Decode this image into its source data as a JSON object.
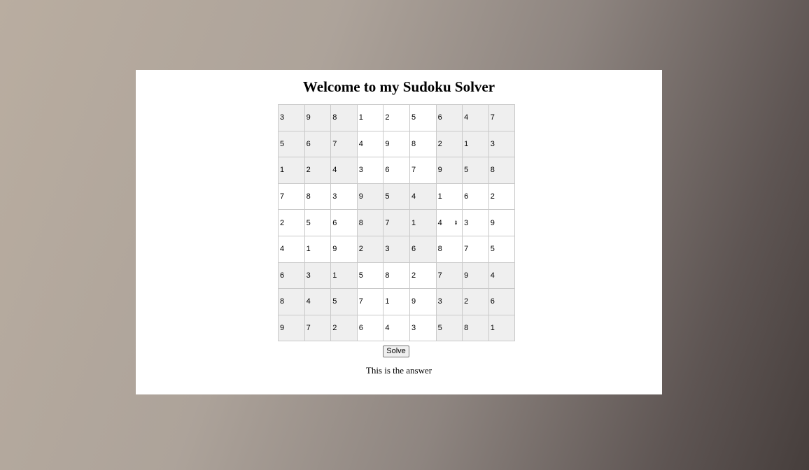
{
  "page": {
    "title": "Welcome to my Sudoku Solver",
    "solve_label": "Solve",
    "answer_text": "This is the answer"
  },
  "grid": [
    [
      "3",
      "9",
      "8",
      "1",
      "2",
      "5",
      "6",
      "4",
      "7"
    ],
    [
      "5",
      "6",
      "7",
      "4",
      "9",
      "8",
      "2",
      "1",
      "3"
    ],
    [
      "1",
      "2",
      "4",
      "3",
      "6",
      "7",
      "9",
      "5",
      "8"
    ],
    [
      "7",
      "8",
      "3",
      "9",
      "5",
      "4",
      "1",
      "6",
      "2"
    ],
    [
      "2",
      "5",
      "6",
      "8",
      "7",
      "1",
      "4",
      "3",
      "9"
    ],
    [
      "4",
      "1",
      "9",
      "2",
      "3",
      "6",
      "8",
      "7",
      "5"
    ],
    [
      "6",
      "3",
      "1",
      "5",
      "8",
      "2",
      "7",
      "9",
      "4"
    ],
    [
      "8",
      "4",
      "5",
      "7",
      "1",
      "9",
      "3",
      "2",
      "6"
    ],
    [
      "9",
      "7",
      "2",
      "6",
      "4",
      "3",
      "5",
      "8",
      "1"
    ]
  ],
  "focused_cell": {
    "row": 4,
    "col": 6
  },
  "colors": {
    "shaded_box": "#efefef",
    "plain_box": "#ffffff",
    "cell_border": "#c9c9c9"
  },
  "icons": {
    "spinner": "up-down-spinner-icon"
  }
}
